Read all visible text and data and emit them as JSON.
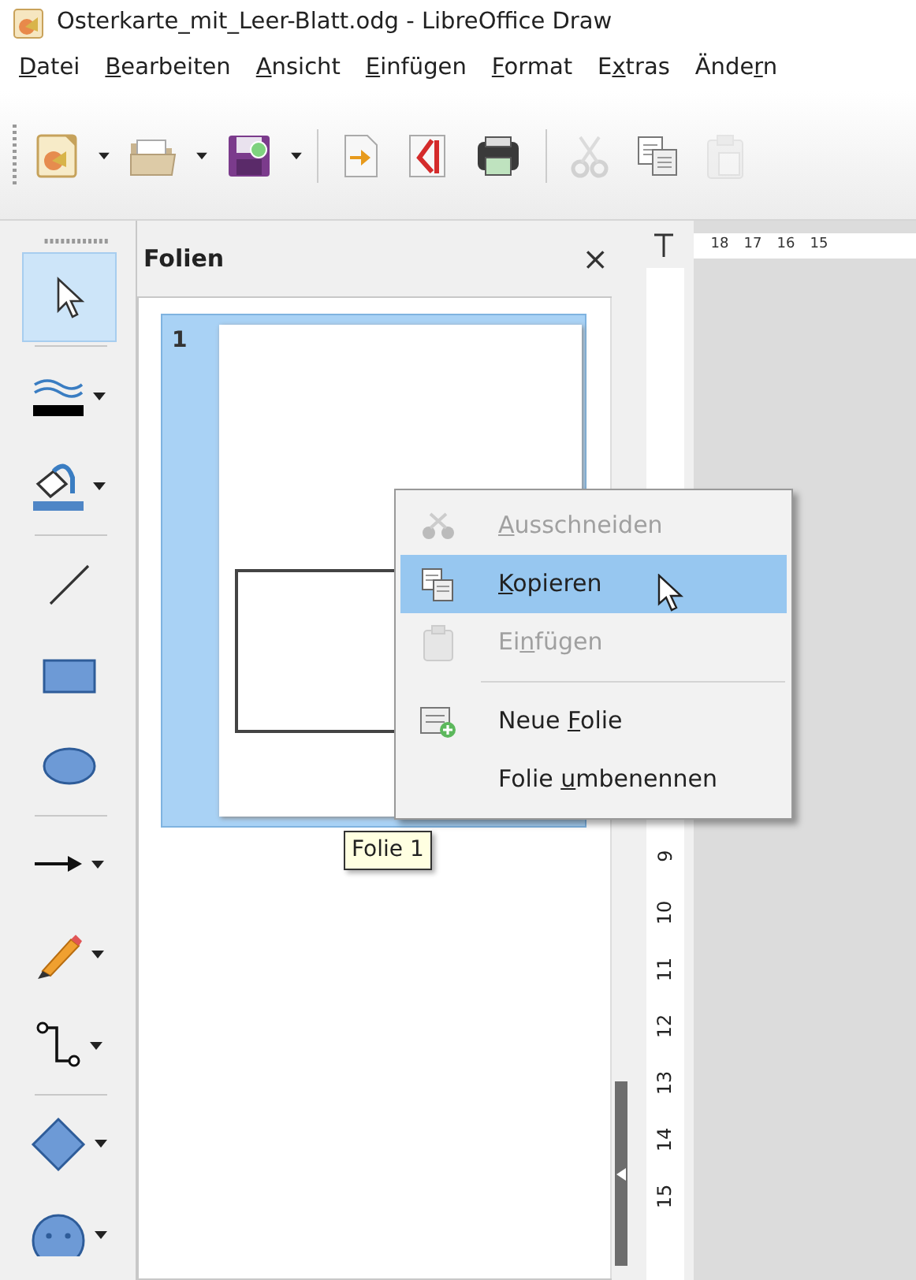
{
  "window": {
    "title": "Osterkarte_mit_Leer-Blatt.odg - LibreOffice Draw"
  },
  "menu": [
    {
      "key": "D",
      "post": "atei"
    },
    {
      "key": "B",
      "post": "earbeiten"
    },
    {
      "key": "A",
      "post": "nsicht"
    },
    {
      "key": "E",
      "post": "infügen"
    },
    {
      "key": "F",
      "post": "ormat"
    },
    {
      "pre": "E",
      "key": "x",
      "post": "tras"
    },
    {
      "pre": "Ände",
      "key": "r",
      "post": "n"
    }
  ],
  "toolbar": {
    "groups": [
      [
        {
          "dropdown": true,
          "disabled": false
        },
        {
          "dropdown": true,
          "disabled": false
        },
        {
          "dropdown": true,
          "disabled": false
        }
      ],
      [
        {
          "dropdown": false,
          "disabled": false
        },
        {
          "dropdown": false,
          "disabled": false
        },
        {
          "dropdown": false,
          "disabled": false
        }
      ],
      [
        {
          "dropdown": false,
          "disabled": true
        },
        {
          "dropdown": false,
          "disabled": false
        },
        {
          "dropdown": false,
          "disabled": true
        }
      ]
    ]
  },
  "drawing_toolbar": {
    "groups": [
      [
        {
          "selected": true,
          "dropdown": false
        }
      ],
      [
        {
          "selected": false,
          "dropdown": true
        },
        {
          "selected": false,
          "dropdown": true
        }
      ],
      [
        {
          "selected": false,
          "dropdown": false
        },
        {
          "selected": false,
          "dropdown": false
        },
        {
          "selected": false,
          "dropdown": false
        }
      ],
      [
        {
          "selected": false,
          "dropdown": true
        },
        {
          "selected": false,
          "dropdown": true
        },
        {
          "selected": false,
          "dropdown": true
        }
      ],
      [
        {
          "selected": false,
          "dropdown": true
        },
        {
          "selected": false,
          "dropdown": true
        }
      ]
    ]
  },
  "slides_panel": {
    "title": "Folien",
    "close": "×",
    "slides": [
      {
        "number": "1",
        "selected": true
      }
    ],
    "tooltip": "Folie 1"
  },
  "context_menu": [
    {
      "kind": "item",
      "key": "A",
      "post": "usschneiden",
      "disabled": true,
      "selected": false
    },
    {
      "kind": "item",
      "key": "K",
      "post": "opieren",
      "disabled": false,
      "selected": true
    },
    {
      "kind": "item",
      "pre": "Ei",
      "key": "n",
      "post": "fügen",
      "disabled": true,
      "selected": false
    },
    {
      "kind": "separator"
    },
    {
      "kind": "item",
      "pre": "Neue ",
      "key": "F",
      "post": "olie",
      "disabled": false,
      "selected": false
    },
    {
      "kind": "item",
      "pre": "Folie ",
      "key": "u",
      "post": "mbenennen",
      "disabled": false,
      "selected": false
    }
  ],
  "ruler": {
    "horizontal": [
      "18",
      "17",
      "16",
      "15"
    ],
    "vertical": [
      "9",
      "10",
      "11",
      "12",
      "13",
      "14",
      "15"
    ]
  }
}
